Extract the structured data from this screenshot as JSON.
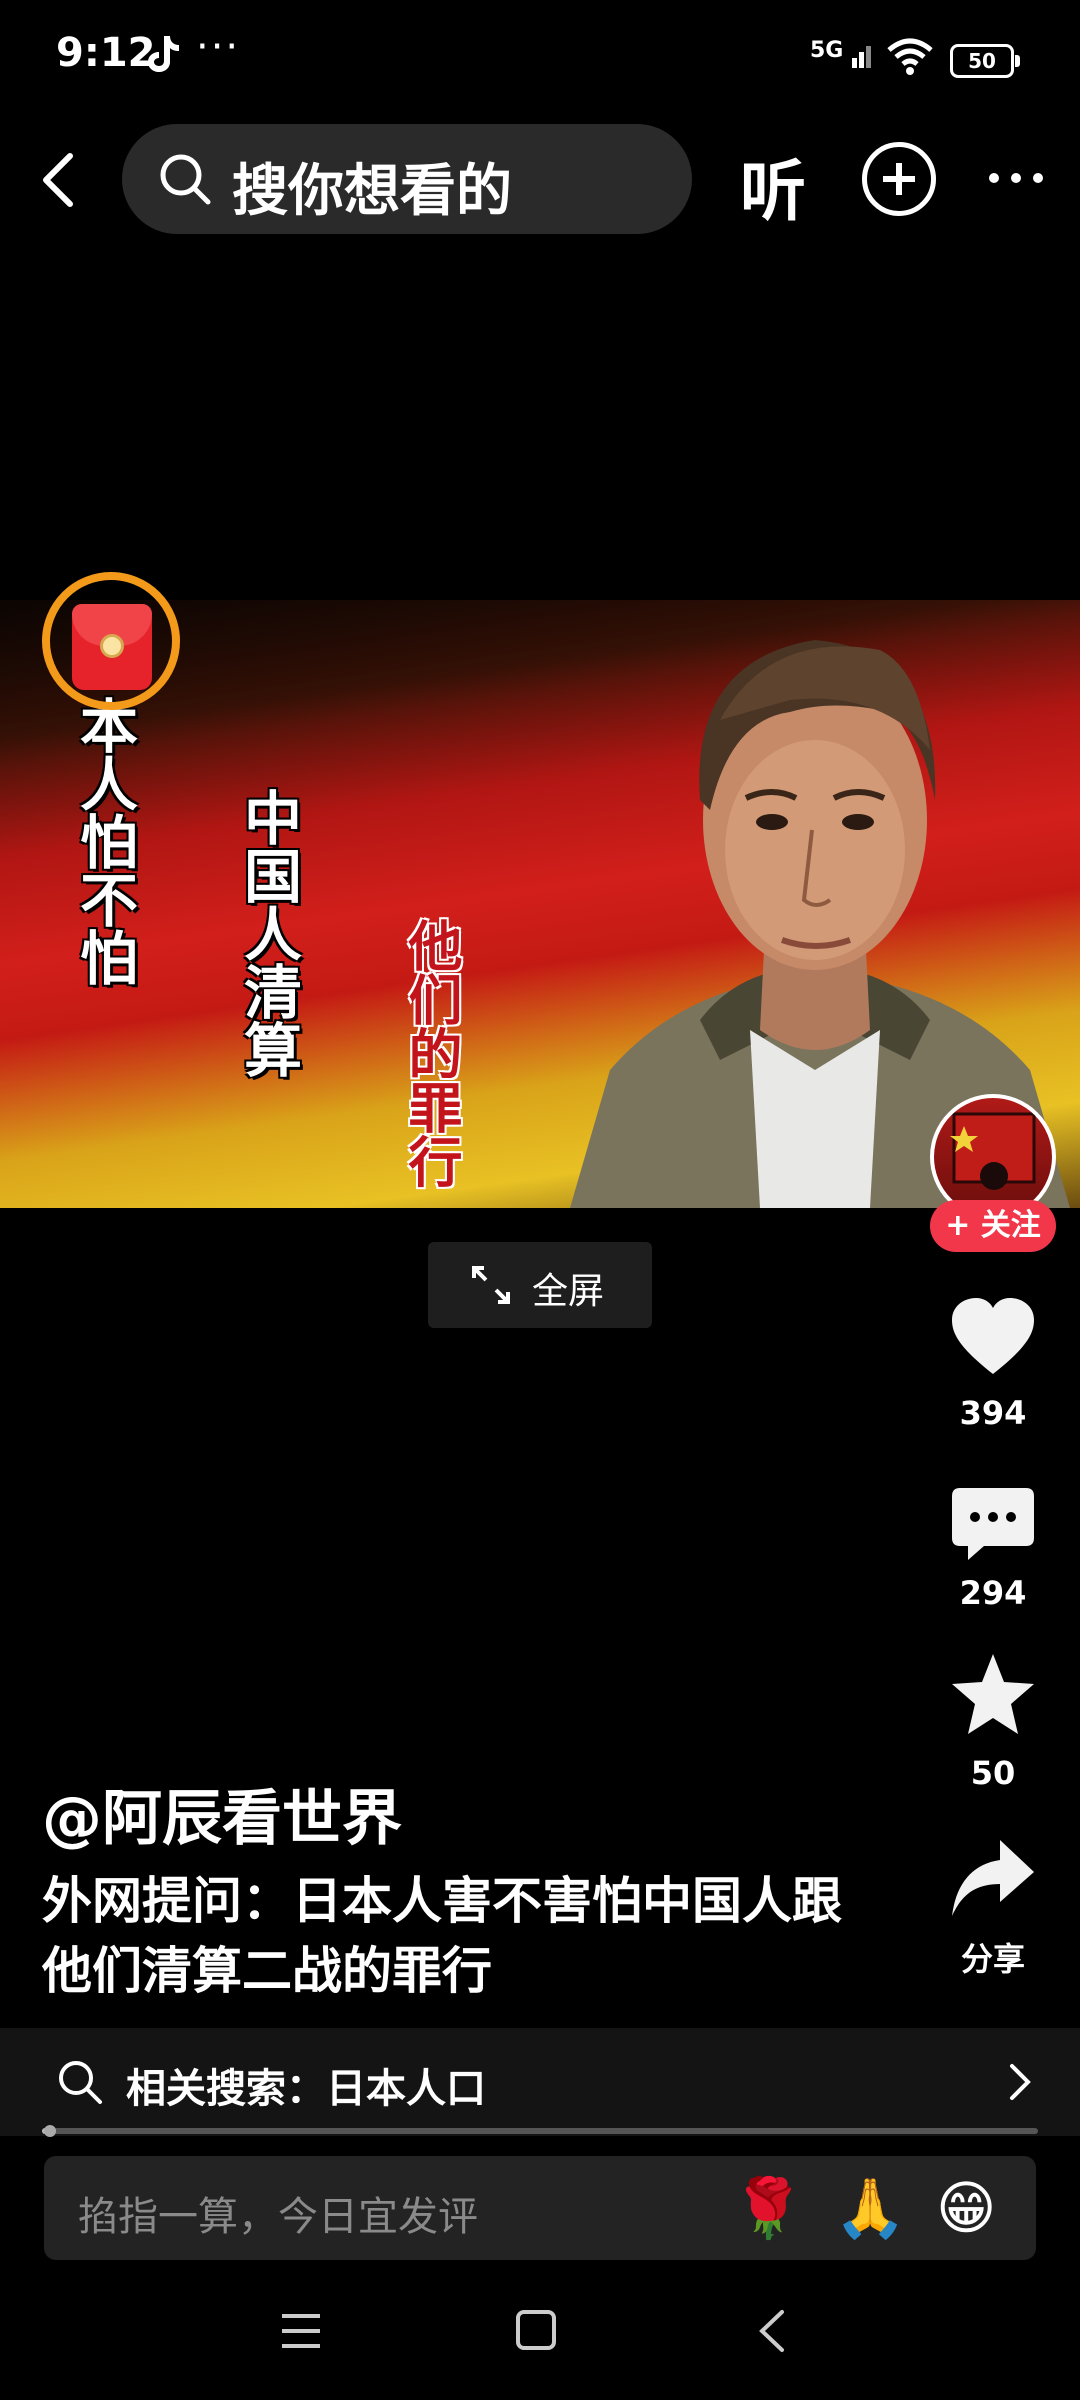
{
  "status_bar": {
    "time": "9:12",
    "dots": "···",
    "network": "5G",
    "battery": "50"
  },
  "top_bar": {
    "search_placeholder": "搜你想看的",
    "listen_label": "听"
  },
  "video": {
    "overlay_text_1": "本人怕不怕",
    "overlay_text_2": "中国人清算",
    "overlay_text_3": "他们的罪行",
    "fullscreen_label": "全屏"
  },
  "actions": {
    "follow_label": "+ 关注",
    "like_count": "394",
    "comment_count": "294",
    "favorite_count": "50",
    "share_label": "分享"
  },
  "caption": {
    "author": "@阿辰看世界",
    "description": "外网提问：日本人害不害怕中国人跟他们清算二战的罪行"
  },
  "related": {
    "label": "相关搜索：日本人口"
  },
  "comment_box": {
    "placeholder": "掐指一算，今日宜发评",
    "emojis": [
      "🌹",
      "🙏",
      "😁"
    ]
  },
  "colors": {
    "follow": "#f2374a",
    "accent_ring": "#f39a1a"
  }
}
